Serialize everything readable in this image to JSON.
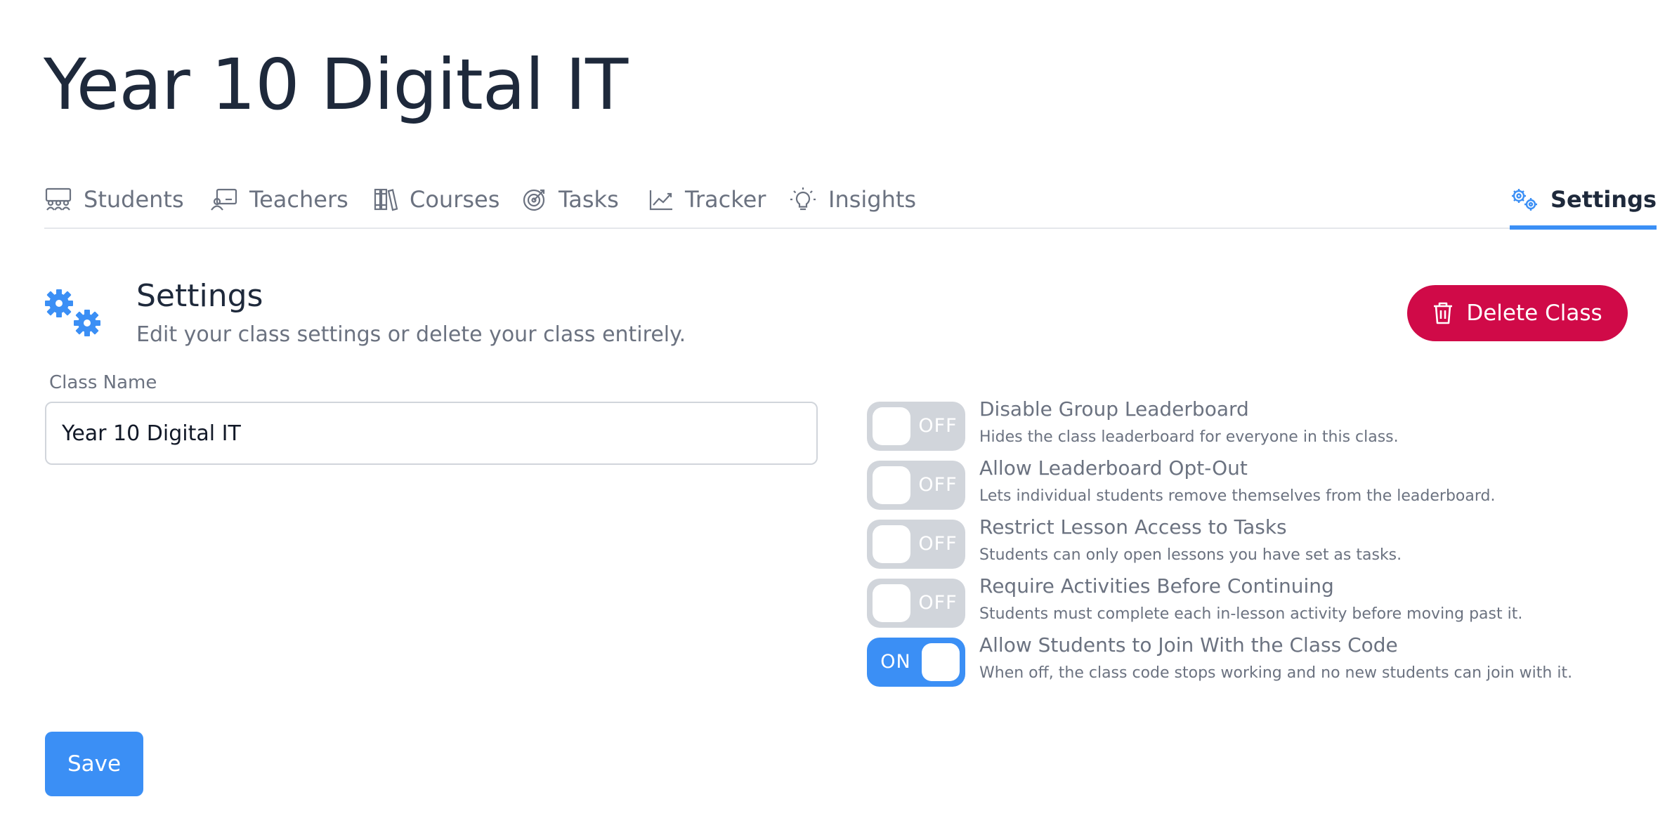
{
  "page": {
    "title": "Year 10 Digital IT"
  },
  "tabs": [
    {
      "label": "Students",
      "icon": "students-icon"
    },
    {
      "label": "Teachers",
      "icon": "teacher-icon"
    },
    {
      "label": "Courses",
      "icon": "books-icon"
    },
    {
      "label": "Tasks",
      "icon": "target-icon"
    },
    {
      "label": "Tracker",
      "icon": "trend-chart-icon"
    },
    {
      "label": "Insights",
      "icon": "lightbulb-icon"
    },
    {
      "label": "Settings",
      "icon": "gears-icon",
      "active": true
    }
  ],
  "section": {
    "title": "Settings",
    "subtitle": "Edit your class settings or delete your class entirely.",
    "delete_label": "Delete Class"
  },
  "form": {
    "class_name_label": "Class Name",
    "class_name_value": "Year 10 Digital IT",
    "save_label": "Save"
  },
  "toggles": [
    {
      "title": "Disable Group Leaderboard",
      "description": "Hides the class leaderboard for everyone in this class.",
      "state": "OFF"
    },
    {
      "title": "Allow Leaderboard Opt-Out",
      "description": "Lets individual students remove themselves from the leaderboard.",
      "state": "OFF"
    },
    {
      "title": "Restrict Lesson Access to Tasks",
      "description": "Students can only open lessons you have set as tasks.",
      "state": "OFF"
    },
    {
      "title": "Require Activities Before Continuing",
      "description": "Students must complete each in-lesson activity before moving past it.",
      "state": "OFF"
    },
    {
      "title": "Allow Students to Join With the Class Code",
      "description": "When off, the class code stops working and no new students can join with it.",
      "state": "ON"
    }
  ],
  "colors": {
    "accent": "#3b8ff5",
    "danger": "#d00a48",
    "toggle_off": "#d1d5db",
    "title": "#1e293b",
    "muted": "#6b7280"
  }
}
